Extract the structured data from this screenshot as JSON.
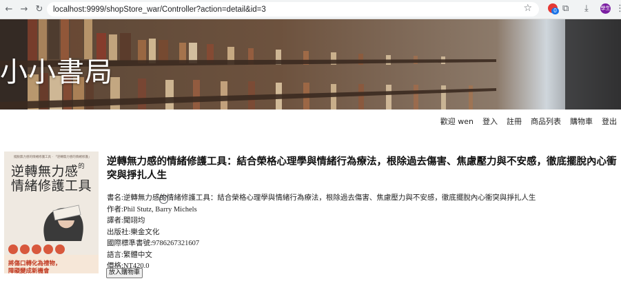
{
  "browser": {
    "url": "localhost:9999/shopStore_war/Controller?action=detail&id=3",
    "ext_badge": "0",
    "avatar_text": "學生"
  },
  "site": {
    "title": "小小書局"
  },
  "nav": {
    "items": [
      {
        "label": "歡迎 wen"
      },
      {
        "label": "登入"
      },
      {
        "label": "註冊"
      },
      {
        "label": "商品列表"
      },
      {
        "label": "購物車"
      },
      {
        "label": "登出"
      }
    ]
  },
  "cover": {
    "top_text": "擺脫無力感的情緒修護工具 · 「逆轉無力感的情緒修護」",
    "title_line1": "逆轉無力感",
    "title_line1_suffix": "的",
    "title_line2": "情緒修護工具",
    "bottom_line1": "將傷口轉化為禮物，",
    "bottom_line2": "障礙變成新機會"
  },
  "product": {
    "title": "逆轉無力感的情緒修護工具：結合榮格心理學與情緒行為療法，根除過去傷害、焦慮壓力與不安感，徹底擺脫內心衝突與掙扎人生",
    "name_line": "書名:逆轉無力感的情緒修護工具：結合榮格心理學與情緒行為療法，根除過去傷害、焦慮壓力與不安感，徹底擺脫內心衝突與掙扎人生",
    "author_line": "作者:Phil Stutz, Barry Michels",
    "translator_line": "譯者:聞翊均",
    "publisher_line": "出版社:樂金文化",
    "isbn_line": "國際標準書號:9786267321607",
    "language_line": "語言:繁體中文",
    "price_line": "價格:NT420.0",
    "add_to_cart_label": "放入購物車"
  }
}
